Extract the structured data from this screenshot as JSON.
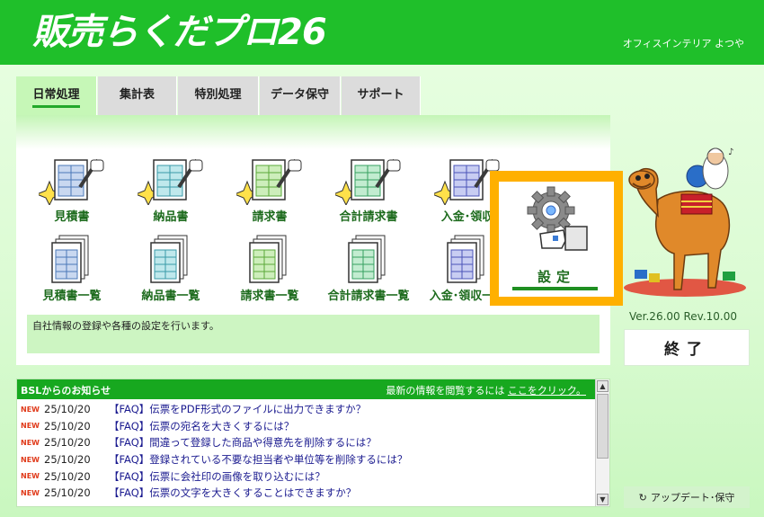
{
  "header": {
    "app_title": "販売らくだプロ26",
    "company": "オフィスインテリア よつや"
  },
  "tabs": [
    {
      "label": "日常処理",
      "active": true
    },
    {
      "label": "集計表",
      "active": false
    },
    {
      "label": "特別処理",
      "active": false
    },
    {
      "label": "データ保守",
      "active": false
    },
    {
      "label": "サポート",
      "active": false
    }
  ],
  "tools_row1": [
    {
      "label": "見積書",
      "icon": "estimate-doc-icon"
    },
    {
      "label": "納品書",
      "icon": "delivery-doc-icon"
    },
    {
      "label": "請求書",
      "icon": "invoice-doc-icon"
    },
    {
      "label": "合計請求書",
      "icon": "total-invoice-doc-icon"
    },
    {
      "label": "入金･領収",
      "icon": "receipt-doc-icon"
    }
  ],
  "tools_row2": [
    {
      "label": "見積書一覧",
      "icon": "estimate-list-icon"
    },
    {
      "label": "納品書一覧",
      "icon": "delivery-list-icon"
    },
    {
      "label": "請求書一覧",
      "icon": "invoice-list-icon"
    },
    {
      "label": "合計請求書一覧",
      "icon": "total-invoice-list-icon"
    },
    {
      "label": "入金･領収一覧",
      "icon": "receipt-list-icon"
    }
  ],
  "settings": {
    "label": "設定",
    "icon": "gear-hand-icon"
  },
  "description": "自社情報の登録や各種の設定を行います。",
  "version": "Ver.26.00  Rev.10.00",
  "exit_label": "終了",
  "news": {
    "title": "BSLからのお知らせ",
    "more_text": "最新の情報を閲覧するには",
    "more_link": "ここをクリック。",
    "new_badge": "NEW",
    "items": [
      {
        "date": "25/10/20",
        "text": "【FAQ】伝票をPDF形式のファイルに出力できますか？"
      },
      {
        "date": "25/10/20",
        "text": "【FAQ】伝票の宛名を大きくするには？"
      },
      {
        "date": "25/10/20",
        "text": "【FAQ】間違って登録した商品や得意先を削除するには？"
      },
      {
        "date": "25/10/20",
        "text": "【FAQ】登録されている不要な担当者や単位等を削除するには？"
      },
      {
        "date": "25/10/20",
        "text": "【FAQ】伝票に会社印の画像を取り込むには？"
      },
      {
        "date": "25/10/20",
        "text": "【FAQ】伝票の文字を大きくすることはできますか？"
      }
    ]
  },
  "update_label": "アップデート･保守",
  "colors": {
    "header_green": "#1fbf2a",
    "highlight_orange": "#ffb000",
    "label_green": "#1d6b1d"
  }
}
